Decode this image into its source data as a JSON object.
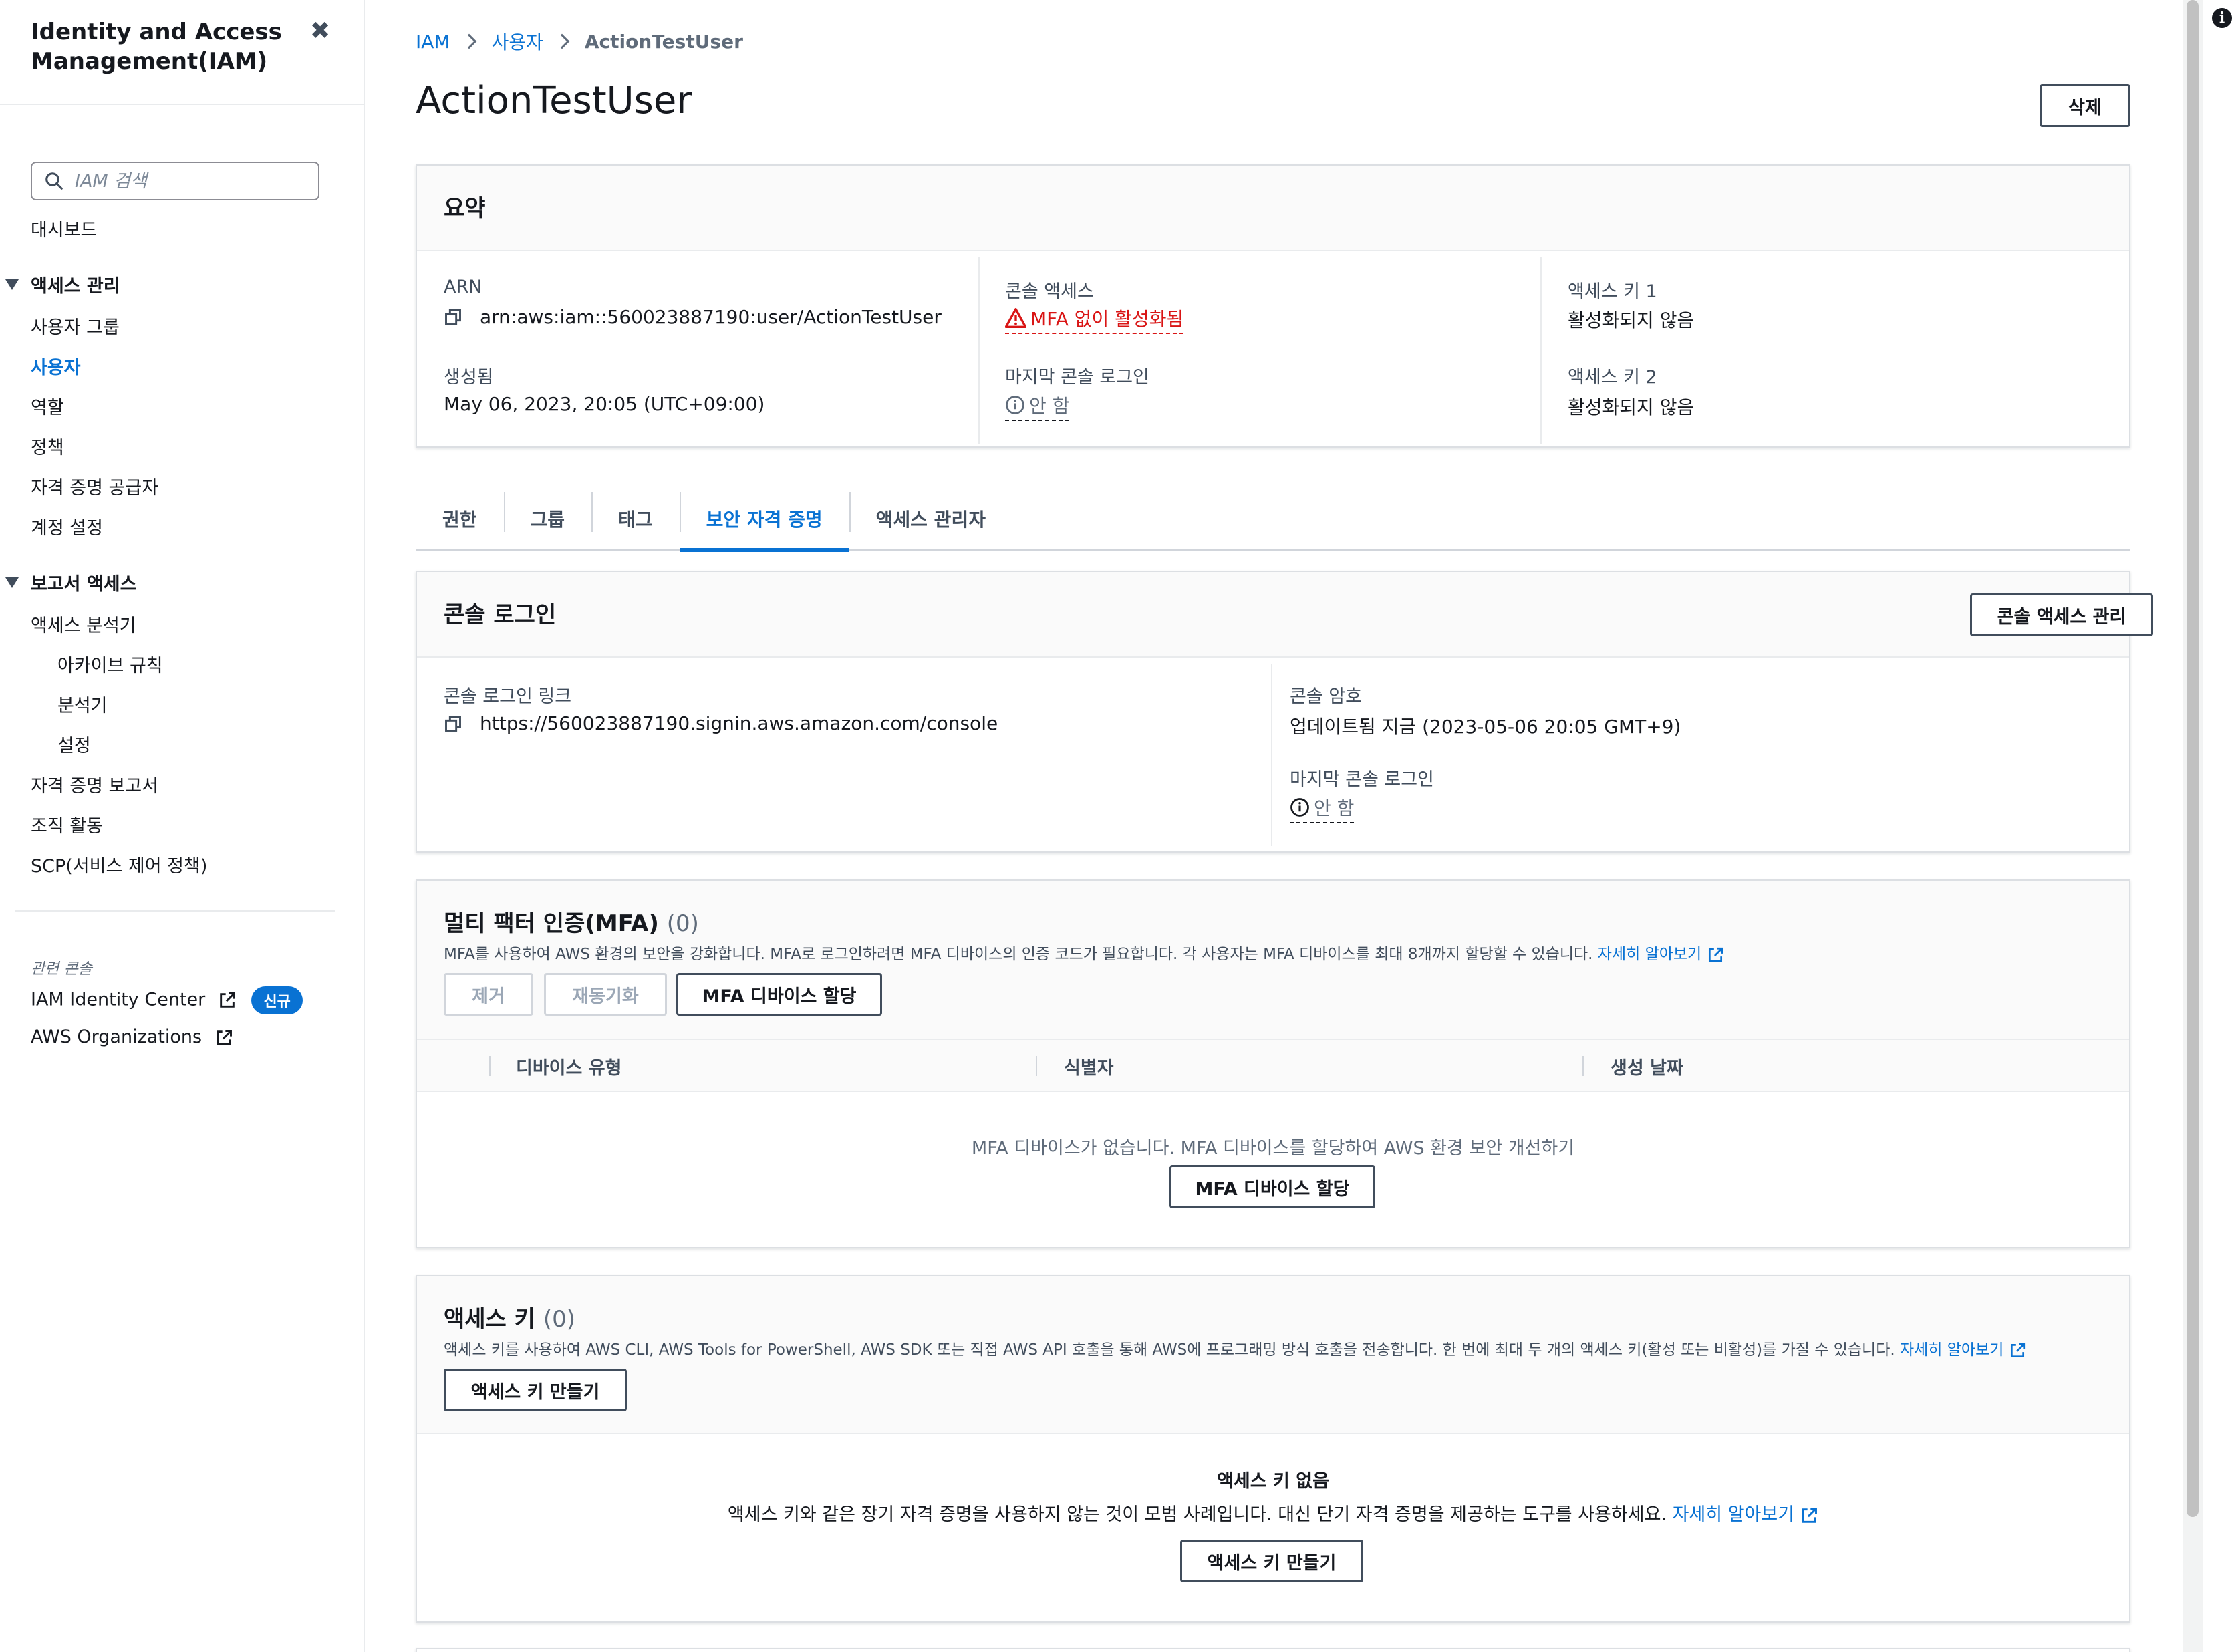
{
  "sidebar": {
    "title": "Identity and Access Management(IAM)",
    "search_placeholder": "IAM 검색",
    "dashboard": "대시보드",
    "access_management": {
      "label": "액세스 관리",
      "items": [
        "사용자 그룹",
        "사용자",
        "역할",
        "정책",
        "자격 증명 공급자",
        "계정 설정"
      ],
      "active_item": "사용자"
    },
    "reports": {
      "label": "보고서 액세스",
      "analyzer": "액세스 분석기",
      "analyzer_sub": [
        "아카이브 규칙",
        "분석기",
        "설정"
      ],
      "items": [
        "자격 증명 보고서",
        "조직 활동",
        "SCP(서비스 제어 정책)"
      ]
    },
    "related_label": "관련 콘솔",
    "related": [
      {
        "label": "IAM Identity Center",
        "badge": "신규"
      },
      {
        "label": "AWS Organizations"
      }
    ]
  },
  "breadcrumb": {
    "root": "IAM",
    "users": "사용자",
    "current": "ActionTestUser"
  },
  "page": {
    "title": "ActionTestUser",
    "delete_label": "삭제"
  },
  "summary": {
    "title": "요약",
    "arn_label": "ARN",
    "arn_value": "arn:aws:iam::560023887190:user/ActionTestUser",
    "created_label": "생성됨",
    "created_value": "May 06, 2023, 20:05 (UTC+09:00)",
    "console_access_label": "콘솔 액세스",
    "console_access_value": "MFA 없이 활성화됨",
    "last_login_label": "마지막 콘솔 로그인",
    "last_login_value": "안 함",
    "key1_label": "액세스 키 1",
    "key1_value": "활성화되지 않음",
    "key2_label": "액세스 키 2",
    "key2_value": "활성화되지 않음"
  },
  "tabs": [
    "권한",
    "그룹",
    "태그",
    "보안 자격 증명",
    "액세스 관리자"
  ],
  "active_tab": "보안 자격 증명",
  "console_login": {
    "title": "콘솔 로그인",
    "manage_button": "콘솔 액세스 관리",
    "link_label": "콘솔 로그인 링크",
    "link_value": "https://560023887190.signin.aws.amazon.com/console",
    "password_label": "콘솔 암호",
    "password_value": "업데이트됨 지금 (2023-05-06 20:05 GMT+9)",
    "last_login_label": "마지막 콘솔 로그인",
    "last_login_value": "안 함"
  },
  "mfa": {
    "title": "멀티 팩터 인증(MFA)",
    "count": "(0)",
    "description": "MFA를 사용하여 AWS 환경의 보안을 강화합니다. MFA로 로그인하려면 MFA 디바이스의 인증 코드가 필요합니다. 각 사용자는 MFA 디바이스를 최대 8개까지 할당할 수 있습니다.",
    "learn_more": "자세히 알아보기",
    "remove_button": "제거",
    "resync_button": "재동기화",
    "assign_button": "MFA 디바이스 할당",
    "columns": [
      "디바이스 유형",
      "식별자",
      "생성 날짜"
    ],
    "empty_text": "MFA 디바이스가 없습니다. MFA 디바이스를 할당하여 AWS 환경 보안 개선하기",
    "empty_button": "MFA 디바이스 할당"
  },
  "access_keys": {
    "title": "액세스 키",
    "count": "(0)",
    "description": "액세스 키를 사용하여 AWS CLI, AWS Tools for PowerShell, AWS SDK 또는 직접 AWS API 호출을 통해 AWS에 프로그래밍 방식 호출을 전송합니다. 한 번에 최대 두 개의 액세스 키(활성 또는 비활성)를 가질 수 있습니다.",
    "learn_more": "자세히 알아보기",
    "create_button": "액세스 키 만들기",
    "empty_title": "액세스 키 없음",
    "empty_text": "액세스 키와 같은 장기 자격 증명을 사용하지 않는 것이 모범 사례입니다. 대신 단기 자격 증명을 제공하는 도구를 사용하세요.",
    "empty_learn_more": "자세히 알아보기",
    "empty_button": "액세스 키 만들기"
  },
  "colors": {
    "link": "#0972d3",
    "error": "#d91515",
    "border": "#414d5c"
  }
}
